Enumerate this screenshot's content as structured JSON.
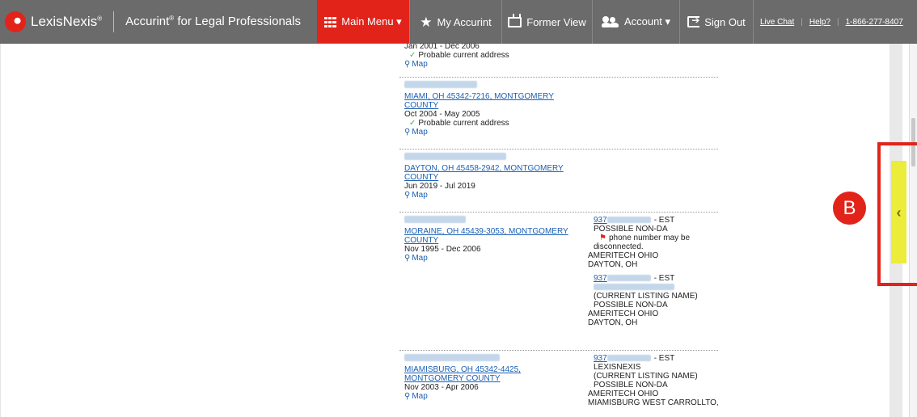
{
  "header": {
    "brand": "LexisNexis",
    "brand_mark": "®",
    "product": "Accurint",
    "product_mark": "®",
    "product_suffix": " for Legal Professionals",
    "main_menu": "Main Menu ▾",
    "my_accurint": "My Accurint",
    "former_view": "Former View",
    "account": "Account ▾",
    "sign_out": "Sign Out",
    "live_chat": "Live Chat",
    "help": "Help?",
    "phone": "1-866-277-8407"
  },
  "records": [
    {
      "dates": "Jan 2001 - Dec 2006",
      "current": "Probable current address",
      "map": "Map"
    },
    {
      "address": "MIAMI, OH 45342-7216, MONTGOMERY COUNTY",
      "dates": "Oct 2004 - May 2005",
      "current": "Probable current address",
      "map": "Map"
    },
    {
      "address": "DAYTON, OH 45458-2942, MONTGOMERY COUNTY",
      "dates": "Jun 2019 - Jul 2019",
      "map": "Map"
    },
    {
      "address": "MORAINE, OH 45439-3053, MONTGOMERY COUNTY",
      "dates": "Nov 1995 - Dec 2006",
      "map": "Map",
      "phones": [
        {
          "prefix": "937",
          "zone": "- EST",
          "line1": "POSSIBLE NON-DA",
          "warning": "phone number may be",
          "warning2": "disconnected.",
          "carrier": "AMERITECH OHIO",
          "city": "DAYTON, OH"
        },
        {
          "prefix": "937",
          "zone": "- EST",
          "listing": "(CURRENT LISTING NAME)",
          "line1": "POSSIBLE NON-DA",
          "carrier": "AMERITECH OHIO",
          "city": "DAYTON, OH"
        }
      ]
    },
    {
      "address": "MIAMISBURG, OH 45342-4425, MONTGOMERY COUNTY",
      "dates": "Nov 2003 - Apr 2006",
      "map": "Map",
      "phones": [
        {
          "prefix": "937",
          "zone": "- EST",
          "name": "LEXISNEXIS",
          "listing": "(CURRENT LISTING NAME)",
          "line1": "POSSIBLE NON-DA",
          "carrier": "AMERITECH OHIO",
          "city": "MIAMISBURG WEST CARROLLTO,"
        }
      ]
    }
  ],
  "callout": {
    "badge": "B",
    "tab_glyph": "‹"
  }
}
